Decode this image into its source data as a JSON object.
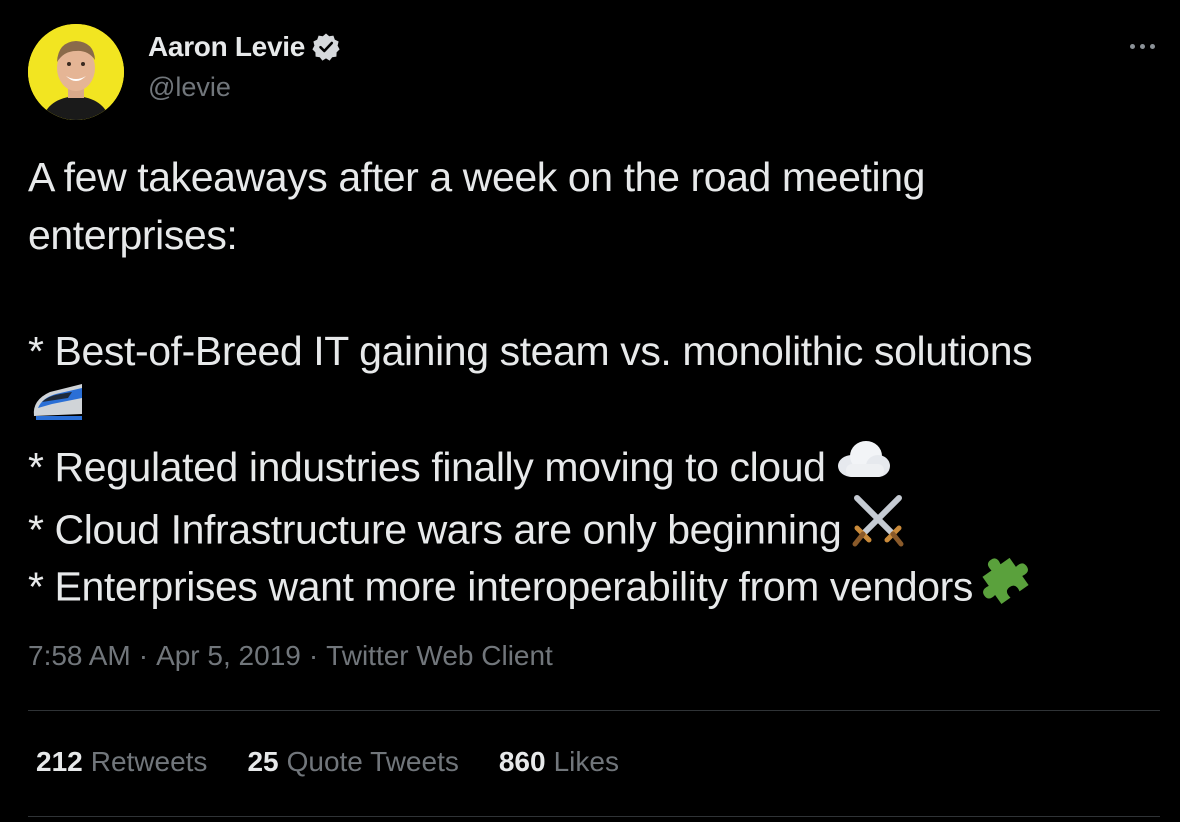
{
  "author": {
    "display_name": "Aaron Levie",
    "handle": "@levie",
    "verified": true,
    "avatar_bg": "#f2e521"
  },
  "tweet": {
    "lines": [
      "A few takeaways after a week on the road meeting",
      "enterprises:",
      "",
      "* Best-of-Breed IT gaining steam vs. monolithic solutions",
      "",
      "* Regulated industries finally moving to cloud",
      "* Cloud Infrastructure wars are only beginning",
      "* Enterprises want more interoperability from vendors"
    ],
    "emojis": [
      "bullet-train-emoji",
      "cloud-emoji",
      "crossed-swords-emoji",
      "puzzle-piece-emoji"
    ]
  },
  "meta": {
    "time": "7:58 AM",
    "date": "Apr 5, 2019",
    "source": "Twitter Web Client",
    "separator": "·"
  },
  "stats": {
    "retweets_count": "212",
    "retweets_label": "Retweets",
    "quotes_count": "25",
    "quotes_label": "Quote Tweets",
    "likes_count": "860",
    "likes_label": "Likes"
  },
  "colors": {
    "background": "#000000",
    "text_primary": "#e7e9ea",
    "text_secondary": "#71767b",
    "divider": "#2f3336"
  }
}
